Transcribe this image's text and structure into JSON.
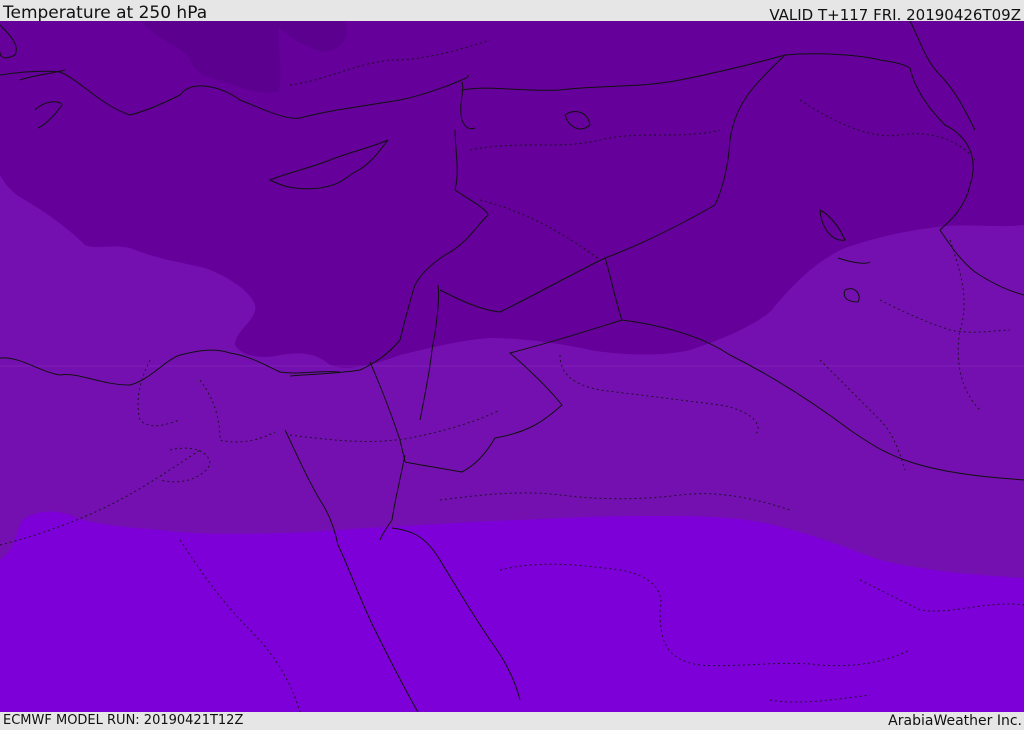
{
  "header": {
    "title": "Temperature at 250 hPa",
    "valid": "VALID T+117 FRI. 20190426T09Z"
  },
  "footer": {
    "model_run": "ECMWF MODEL RUN: 20190421T12Z",
    "credit": "ArabiaWeather Inc."
  },
  "map": {
    "colors": {
      "coldest": "#5c0090",
      "cold": "#65009a",
      "mid": "#7510b0",
      "warm": "#7d00d8",
      "border": "#111111"
    }
  }
}
